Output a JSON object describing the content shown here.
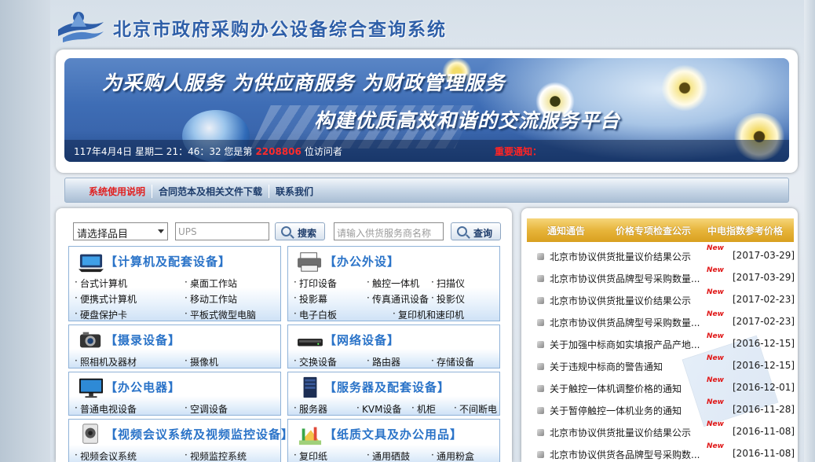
{
  "header": {
    "title": "北京市政府采购办公设备综合查询系统"
  },
  "banner": {
    "slogan_line1": "为采购人服务 为供应商服务 为财政管理服务",
    "slogan_line2": "构建优质高效和谐的交流服务平台",
    "date_text": "117年4月4日 星期二 21：46：32 您是第",
    "visitor_count": "2208806",
    "visitor_suffix": "位访问者",
    "notice_label": "重要通知："
  },
  "nav": {
    "items": [
      "系统使用说明",
      "合同范本及相关文件下载",
      "联系我们"
    ]
  },
  "search": {
    "category_select": "请选择品目",
    "keyword_value": "UPS",
    "search_label": "搜索",
    "supplier_placeholder": "请输入供货服务商名称",
    "query_label": "查询"
  },
  "categories": [
    {
      "title": "【计算机及配套设备】",
      "icon": "laptop-icon",
      "links": [
        [
          "台式计算机",
          "桌面工作站"
        ],
        [
          "便携式计算机",
          "移动工作站"
        ],
        [
          "硬盘保护卡",
          "平板式微型电脑"
        ]
      ]
    },
    {
      "title": "【办公外设】",
      "icon": "printer-icon",
      "links": [
        [
          "打印设备",
          "触控一体机",
          "扫描仪"
        ],
        [
          "投影幕",
          "传真通讯设备",
          "投影仪"
        ],
        [
          "电子白板",
          "复印机和速印机"
        ]
      ]
    },
    {
      "title": "【摄录设备】",
      "icon": "camera-icon",
      "links": [
        [
          "照相机及器材",
          "摄像机"
        ]
      ]
    },
    {
      "title": "【网络设备】",
      "icon": "router-icon",
      "links": [
        [
          "交换设备",
          "路由器",
          "存储设备"
        ]
      ]
    },
    {
      "title": "【办公电器】",
      "icon": "tv-icon",
      "links": [
        [
          "普通电视设备",
          "空调设备"
        ]
      ]
    },
    {
      "title": "【服务器及配套设备】",
      "icon": "server-icon",
      "links": [
        [
          "服务器",
          "KVM设备",
          "机柜",
          "不间断电"
        ]
      ]
    },
    {
      "title": "【视频会议系统及视频监控设备】",
      "icon": "cctv-camera-icon",
      "links": [
        [
          "视频会议系统",
          "视频监控系统"
        ]
      ]
    },
    {
      "title": "【纸质文具及办公用品】",
      "icon": "stationery-icon",
      "links": [
        [
          "复印纸",
          "通用硒鼓",
          "通用粉盒"
        ]
      ]
    }
  ],
  "tabs": [
    "通知通告",
    "价格专项检查公示",
    "中电指数参考价格"
  ],
  "news": [
    {
      "title": "北京市协议供货批量议价结果公示",
      "date": "[2017-03-29]",
      "new": "New"
    },
    {
      "title": "北京市协议供货品牌型号采购数量...",
      "date": "[2017-03-29]",
      "new": "New"
    },
    {
      "title": "北京市协议供货批量议价结果公示",
      "date": "[2017-02-23]",
      "new": "New"
    },
    {
      "title": "北京市协议供货品牌型号采购数量...",
      "date": "[2017-02-23]",
      "new": "New"
    },
    {
      "title": "关于加强中标商如实填报产品产地...",
      "date": "[2016-12-15]",
      "new": "New"
    },
    {
      "title": "关于违规中标商的警告通知",
      "date": "[2016-12-15]",
      "new": "New"
    },
    {
      "title": "关于触控一体机调整价格的通知",
      "date": "[2016-12-01]",
      "new": "New"
    },
    {
      "title": "关于暂停触控一体机业务的通知",
      "date": "[2016-11-28]",
      "new": "New"
    },
    {
      "title": "北京市协议供货批量议价结果公示",
      "date": "[2016-11-08]",
      "new": "New"
    },
    {
      "title": "北京市协议供货各品牌型号采购数...",
      "date": "[2016-11-08]",
      "new": "New"
    }
  ],
  "colors": {
    "title_blue": "#2f5fa8",
    "category_title": "#2a73c8",
    "tab_gold": "#e7b53b",
    "new_red": "#e01818",
    "count_red": "#ff2b2b"
  }
}
